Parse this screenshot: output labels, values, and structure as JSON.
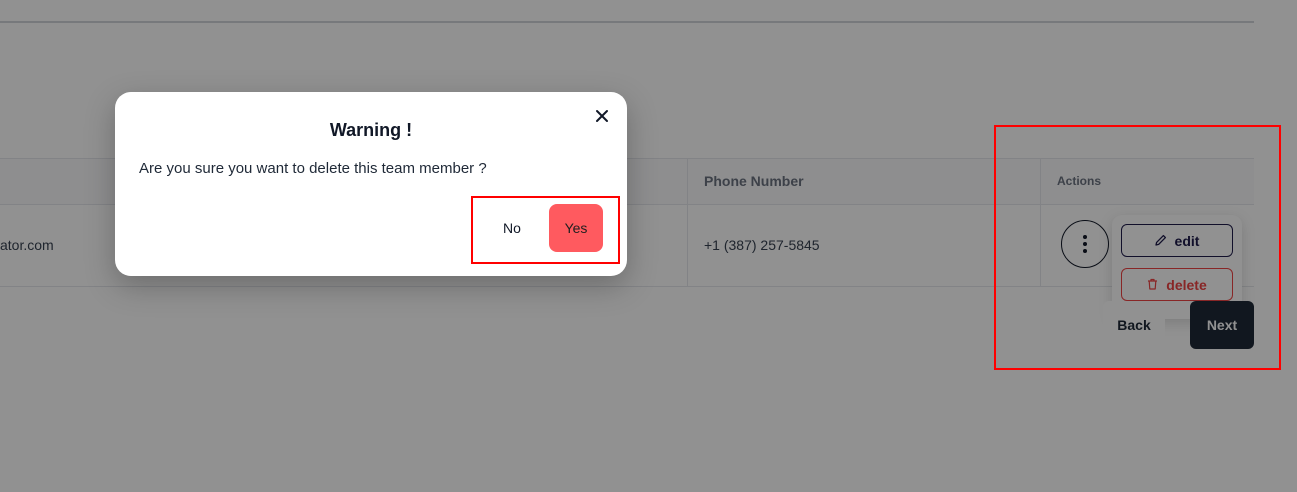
{
  "table": {
    "columns": {
      "phone": "Phone Number",
      "actions": "Actions"
    },
    "rows": [
      {
        "email": "ator.com",
        "phone": "+1 (387) 257-5845"
      }
    ]
  },
  "row_actions": {
    "menu_icon": "vertical-ellipsis-icon",
    "edit_label": "edit",
    "edit_icon": "pencil-icon",
    "delete_label": "delete",
    "delete_icon": "trash-icon"
  },
  "pagination": {
    "back_label": "Back",
    "next_label": "Next"
  },
  "dialog": {
    "title": "Warning !",
    "message": "Are you sure you want to delete this team member ?",
    "close_icon": "close-icon",
    "no_label": "No",
    "yes_label": "Yes"
  },
  "colors": {
    "danger": "#ff5a5f",
    "edit_accent": "#1e1b4b",
    "delete_accent": "#ef4444",
    "primary_dark": "#1f2937",
    "highlight": "#ff0000"
  }
}
